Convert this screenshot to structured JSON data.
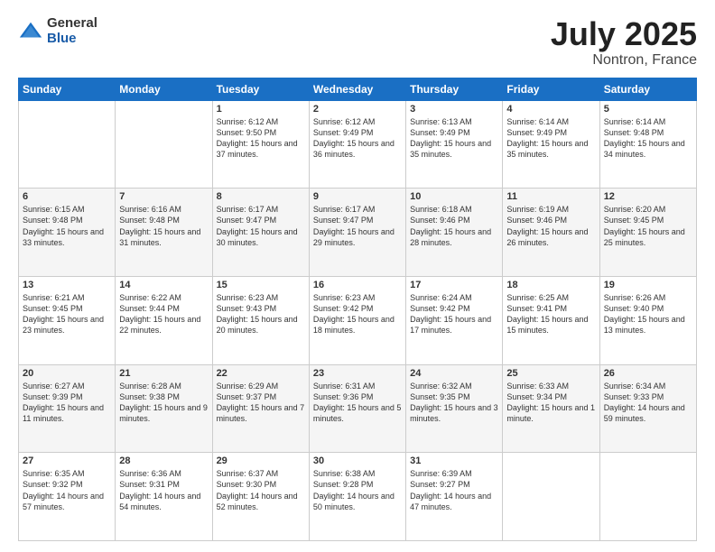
{
  "header": {
    "logo_general": "General",
    "logo_blue": "Blue",
    "title": "July 2025",
    "location": "Nontron, France"
  },
  "weekdays": [
    "Sunday",
    "Monday",
    "Tuesday",
    "Wednesday",
    "Thursday",
    "Friday",
    "Saturday"
  ],
  "weeks": [
    [
      {
        "day": "",
        "content": ""
      },
      {
        "day": "",
        "content": ""
      },
      {
        "day": "1",
        "content": "Sunrise: 6:12 AM\nSunset: 9:50 PM\nDaylight: 15 hours and 37 minutes."
      },
      {
        "day": "2",
        "content": "Sunrise: 6:12 AM\nSunset: 9:49 PM\nDaylight: 15 hours and 36 minutes."
      },
      {
        "day": "3",
        "content": "Sunrise: 6:13 AM\nSunset: 9:49 PM\nDaylight: 15 hours and 35 minutes."
      },
      {
        "day": "4",
        "content": "Sunrise: 6:14 AM\nSunset: 9:49 PM\nDaylight: 15 hours and 35 minutes."
      },
      {
        "day": "5",
        "content": "Sunrise: 6:14 AM\nSunset: 9:48 PM\nDaylight: 15 hours and 34 minutes."
      }
    ],
    [
      {
        "day": "6",
        "content": "Sunrise: 6:15 AM\nSunset: 9:48 PM\nDaylight: 15 hours and 33 minutes."
      },
      {
        "day": "7",
        "content": "Sunrise: 6:16 AM\nSunset: 9:48 PM\nDaylight: 15 hours and 31 minutes."
      },
      {
        "day": "8",
        "content": "Sunrise: 6:17 AM\nSunset: 9:47 PM\nDaylight: 15 hours and 30 minutes."
      },
      {
        "day": "9",
        "content": "Sunrise: 6:17 AM\nSunset: 9:47 PM\nDaylight: 15 hours and 29 minutes."
      },
      {
        "day": "10",
        "content": "Sunrise: 6:18 AM\nSunset: 9:46 PM\nDaylight: 15 hours and 28 minutes."
      },
      {
        "day": "11",
        "content": "Sunrise: 6:19 AM\nSunset: 9:46 PM\nDaylight: 15 hours and 26 minutes."
      },
      {
        "day": "12",
        "content": "Sunrise: 6:20 AM\nSunset: 9:45 PM\nDaylight: 15 hours and 25 minutes."
      }
    ],
    [
      {
        "day": "13",
        "content": "Sunrise: 6:21 AM\nSunset: 9:45 PM\nDaylight: 15 hours and 23 minutes."
      },
      {
        "day": "14",
        "content": "Sunrise: 6:22 AM\nSunset: 9:44 PM\nDaylight: 15 hours and 22 minutes."
      },
      {
        "day": "15",
        "content": "Sunrise: 6:23 AM\nSunset: 9:43 PM\nDaylight: 15 hours and 20 minutes."
      },
      {
        "day": "16",
        "content": "Sunrise: 6:23 AM\nSunset: 9:42 PM\nDaylight: 15 hours and 18 minutes."
      },
      {
        "day": "17",
        "content": "Sunrise: 6:24 AM\nSunset: 9:42 PM\nDaylight: 15 hours and 17 minutes."
      },
      {
        "day": "18",
        "content": "Sunrise: 6:25 AM\nSunset: 9:41 PM\nDaylight: 15 hours and 15 minutes."
      },
      {
        "day": "19",
        "content": "Sunrise: 6:26 AM\nSunset: 9:40 PM\nDaylight: 15 hours and 13 minutes."
      }
    ],
    [
      {
        "day": "20",
        "content": "Sunrise: 6:27 AM\nSunset: 9:39 PM\nDaylight: 15 hours and 11 minutes."
      },
      {
        "day": "21",
        "content": "Sunrise: 6:28 AM\nSunset: 9:38 PM\nDaylight: 15 hours and 9 minutes."
      },
      {
        "day": "22",
        "content": "Sunrise: 6:29 AM\nSunset: 9:37 PM\nDaylight: 15 hours and 7 minutes."
      },
      {
        "day": "23",
        "content": "Sunrise: 6:31 AM\nSunset: 9:36 PM\nDaylight: 15 hours and 5 minutes."
      },
      {
        "day": "24",
        "content": "Sunrise: 6:32 AM\nSunset: 9:35 PM\nDaylight: 15 hours and 3 minutes."
      },
      {
        "day": "25",
        "content": "Sunrise: 6:33 AM\nSunset: 9:34 PM\nDaylight: 15 hours and 1 minute."
      },
      {
        "day": "26",
        "content": "Sunrise: 6:34 AM\nSunset: 9:33 PM\nDaylight: 14 hours and 59 minutes."
      }
    ],
    [
      {
        "day": "27",
        "content": "Sunrise: 6:35 AM\nSunset: 9:32 PM\nDaylight: 14 hours and 57 minutes."
      },
      {
        "day": "28",
        "content": "Sunrise: 6:36 AM\nSunset: 9:31 PM\nDaylight: 14 hours and 54 minutes."
      },
      {
        "day": "29",
        "content": "Sunrise: 6:37 AM\nSunset: 9:30 PM\nDaylight: 14 hours and 52 minutes."
      },
      {
        "day": "30",
        "content": "Sunrise: 6:38 AM\nSunset: 9:28 PM\nDaylight: 14 hours and 50 minutes."
      },
      {
        "day": "31",
        "content": "Sunrise: 6:39 AM\nSunset: 9:27 PM\nDaylight: 14 hours and 47 minutes."
      },
      {
        "day": "",
        "content": ""
      },
      {
        "day": "",
        "content": ""
      }
    ]
  ]
}
